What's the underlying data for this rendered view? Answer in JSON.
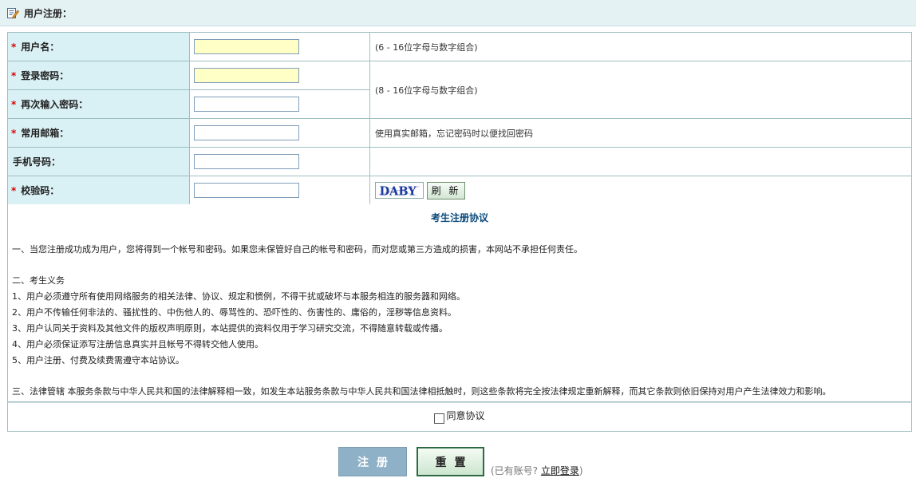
{
  "header": {
    "title": "用户注册：",
    "icon": "edit-document-icon"
  },
  "fields": [
    {
      "label": "用户名：",
      "required": true,
      "value": "",
      "highlight": true,
      "hint": "(6 - 16位字母与数字组合)"
    },
    {
      "label": "登录密码：",
      "required": true,
      "value": "",
      "highlight": true,
      "hint": "(8 - 16位字母与数字组合)"
    },
    {
      "label": "再次输入密码：",
      "required": true,
      "value": ""
    },
    {
      "label": "常用邮箱：",
      "required": true,
      "value": "",
      "hint": "使用真实邮箱，忘记密码时以便找回密码"
    },
    {
      "label": "手机号码：",
      "required": false,
      "value": "",
      "hint": ""
    },
    {
      "label": "校验码：",
      "required": true,
      "value": "",
      "captcha_text": "DABY",
      "refresh_label": "刷 新"
    }
  ],
  "required_mark": "*",
  "agreement": {
    "title": "考生注册协议",
    "lines": [
      "一、当您注册成功成为用户，您将得到一个帐号和密码。如果您未保管好自己的帐号和密码，而对您或第三方造成的损害，本网站不承担任何责任。",
      "二、考生义务",
      "1、用户必须遵守所有使用网络服务的相关法律、协议、规定和惯例，不得干扰或破坏与本服务相连的服务器和网络。",
      "2、用户不传输任何非法的、骚扰性的、中伤他人的、辱骂性的、恐吓性的、伤害性的、庸俗的，淫秽等信息资料。",
      "3、用户认同关于资料及其他文件的版权声明原则，本站提供的资料仅用于学习研究交流，不得随意转载或传播。",
      "4、用户必须保证添写注册信息真实并且帐号不得转交他人使用。",
      "5、用户注册、付费及续费需遵守本站协议。",
      "三、法律管辖 本服务条款与中华人民共和国的法律解释相一致，如发生本站服务条款与中华人民共和国法律相抵触时，则这些条款将完全按法律规定重新解释，而其它条款则依旧保持对用户产生法律效力和影响。"
    ],
    "agree_label": "同意协议",
    "agree_checked": false
  },
  "buttons": {
    "register": "注册",
    "reset": "重置"
  },
  "login_prompt": {
    "prefix": "(已有账号?",
    "link": "立即登录",
    "suffix": ")"
  },
  "colors": {
    "label_bg": "#d9f0f4",
    "border": "#9fbfc3",
    "required": "#e00000",
    "title_blue": "#0b4a7a",
    "register_btn": "#8fb1c8",
    "reset_border": "#2d6a44"
  }
}
